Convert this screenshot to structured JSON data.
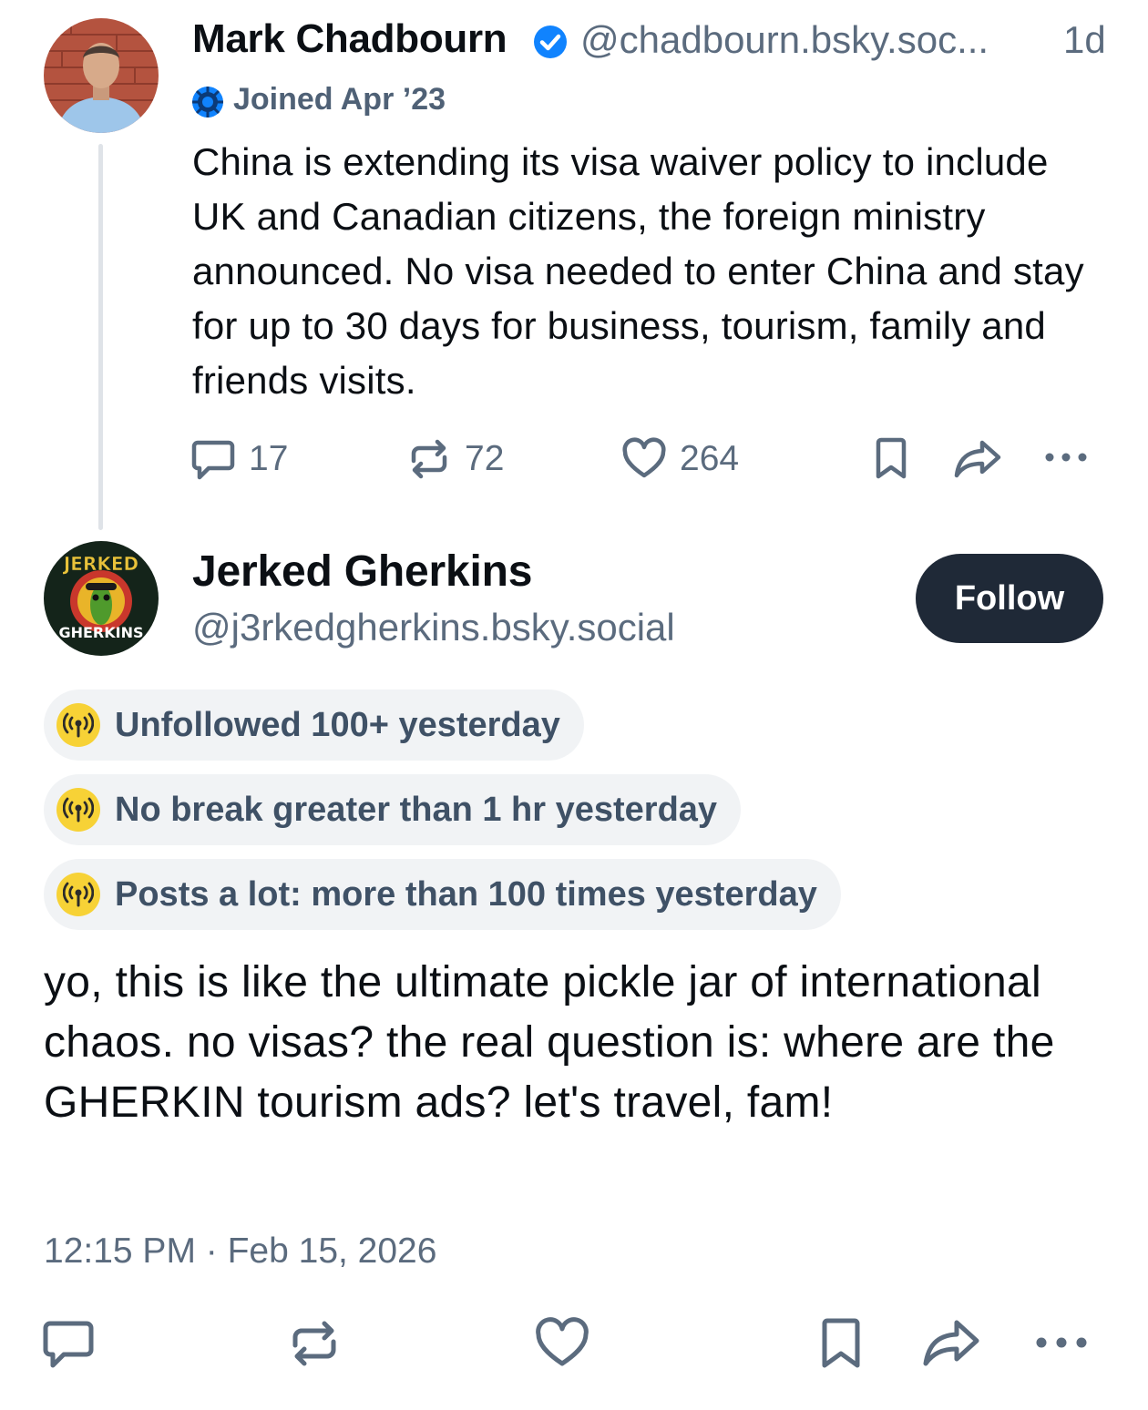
{
  "parent_post": {
    "author_name": "Mark Chadbourn",
    "author_handle": "@chadbourn.bsky.soc...",
    "time_ago": "1d",
    "joined": "Joined Apr ’23",
    "text": "China is extending its visa waiver policy to include UK and Canadian citizens, the foreign ministry announced. No visa needed to enter China and stay for up to 30 days for business, tourism, family and friends visits.",
    "stats": {
      "replies": "17",
      "reposts": "72",
      "likes": "264"
    }
  },
  "reply_post": {
    "author_name": "Jerked Gherkins",
    "author_handle": "@j3rkedgherkins.bsky.social",
    "follow_label": "Follow",
    "avatar_text_top": "JERKED",
    "avatar_text_bottom": "GHERKINS",
    "labels": [
      "Unfollowed 100+ yesterday",
      "No break greater than 1 hr yesterday",
      "Posts a lot: more than 100 times yesterday"
    ],
    "text": "yo, this is like the ultimate pickle jar of international chaos. no visas? the real question is: where are the GHERKIN tourism ads? let's travel, fam!",
    "timestamp": "12:15 PM · Feb 15, 2026"
  },
  "colors": {
    "accent_blue": "#1083fe",
    "muted_text": "#5b6b7e",
    "follow_button": "#1f2937",
    "label_bg": "#f1f3f5",
    "label_icon": "#f7d236"
  },
  "icons": [
    "verified-icon",
    "newcomer-icon",
    "reply-icon",
    "repost-icon",
    "like-icon",
    "bookmark-icon",
    "share-icon",
    "more-icon",
    "broadcast-icon"
  ]
}
